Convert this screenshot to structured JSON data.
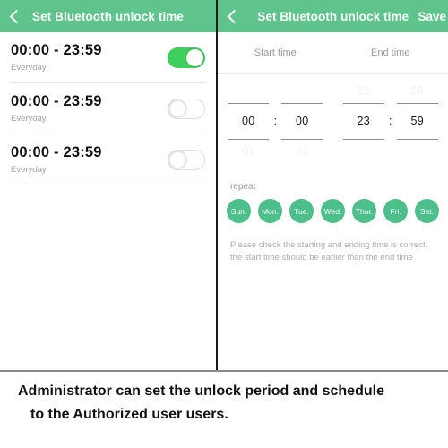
{
  "left_panel": {
    "appbar": {
      "back_icon": "chevron-left-icon",
      "title": "Set Bluetooth unlock time"
    },
    "schedules": [
      {
        "time": "00:00 - 23:59",
        "repeat": "Everyday",
        "enabled": "on"
      },
      {
        "time": "00:00 - 23:59",
        "repeat": "Everyday",
        "enabled": "off"
      },
      {
        "time": "00:00 - 23:59",
        "repeat": "Everyday",
        "enabled": "off"
      }
    ]
  },
  "right_panel": {
    "appbar": {
      "back_icon": "chevron-left-icon",
      "title": "Set Bluetooth unlock time",
      "save_label": "Save"
    },
    "columns": {
      "start_label": "Start time",
      "end_label": "End time"
    },
    "picker": {
      "ghost_above": {
        "start_hour": "",
        "start_minute": "",
        "end_hour": "22",
        "end_minute": "58"
      },
      "selected": {
        "start_hour": "00",
        "start_minute": "00",
        "end_hour": "23",
        "end_minute": "59"
      },
      "ghost_below": {
        "start_hour": "01",
        "start_minute": "01",
        "end_hour": "",
        "end_minute": ""
      },
      "separator": ":"
    },
    "repeat": {
      "label": "repeat",
      "days": [
        "Sun.",
        "Mon.",
        "Tue.",
        "Wed.",
        "Thur.",
        "Fri.",
        "Sat."
      ]
    },
    "hint": "Please check the starting and ending time is correct, the start time should be earlier than the end time"
  },
  "caption": {
    "line1": "Administrator can set the unlock period and schedule",
    "line2": "to the Authorized user users."
  },
  "colors": {
    "appbar_green": "#5fc48c",
    "toggle_on_green": "#3ecf5c",
    "day_green": "#4cbf8a"
  }
}
